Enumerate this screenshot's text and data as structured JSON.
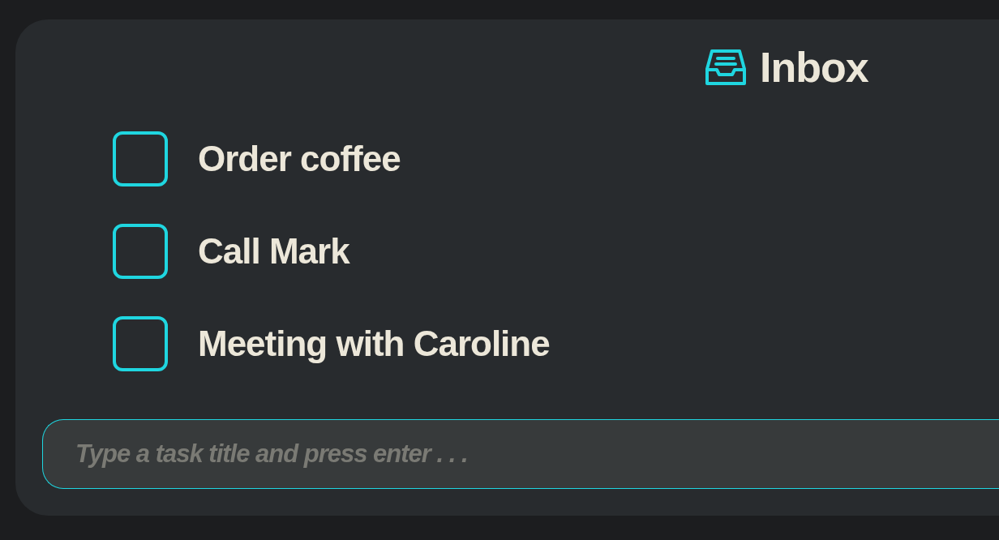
{
  "header": {
    "title": "Inbox"
  },
  "tasks": [
    {
      "title": "Order coffee",
      "checked": false
    },
    {
      "title": "Call Mark",
      "checked": false
    },
    {
      "title": "Meeting with Caroline",
      "checked": false
    }
  ],
  "new_task": {
    "placeholder": "Type a task title and press enter . . ."
  }
}
